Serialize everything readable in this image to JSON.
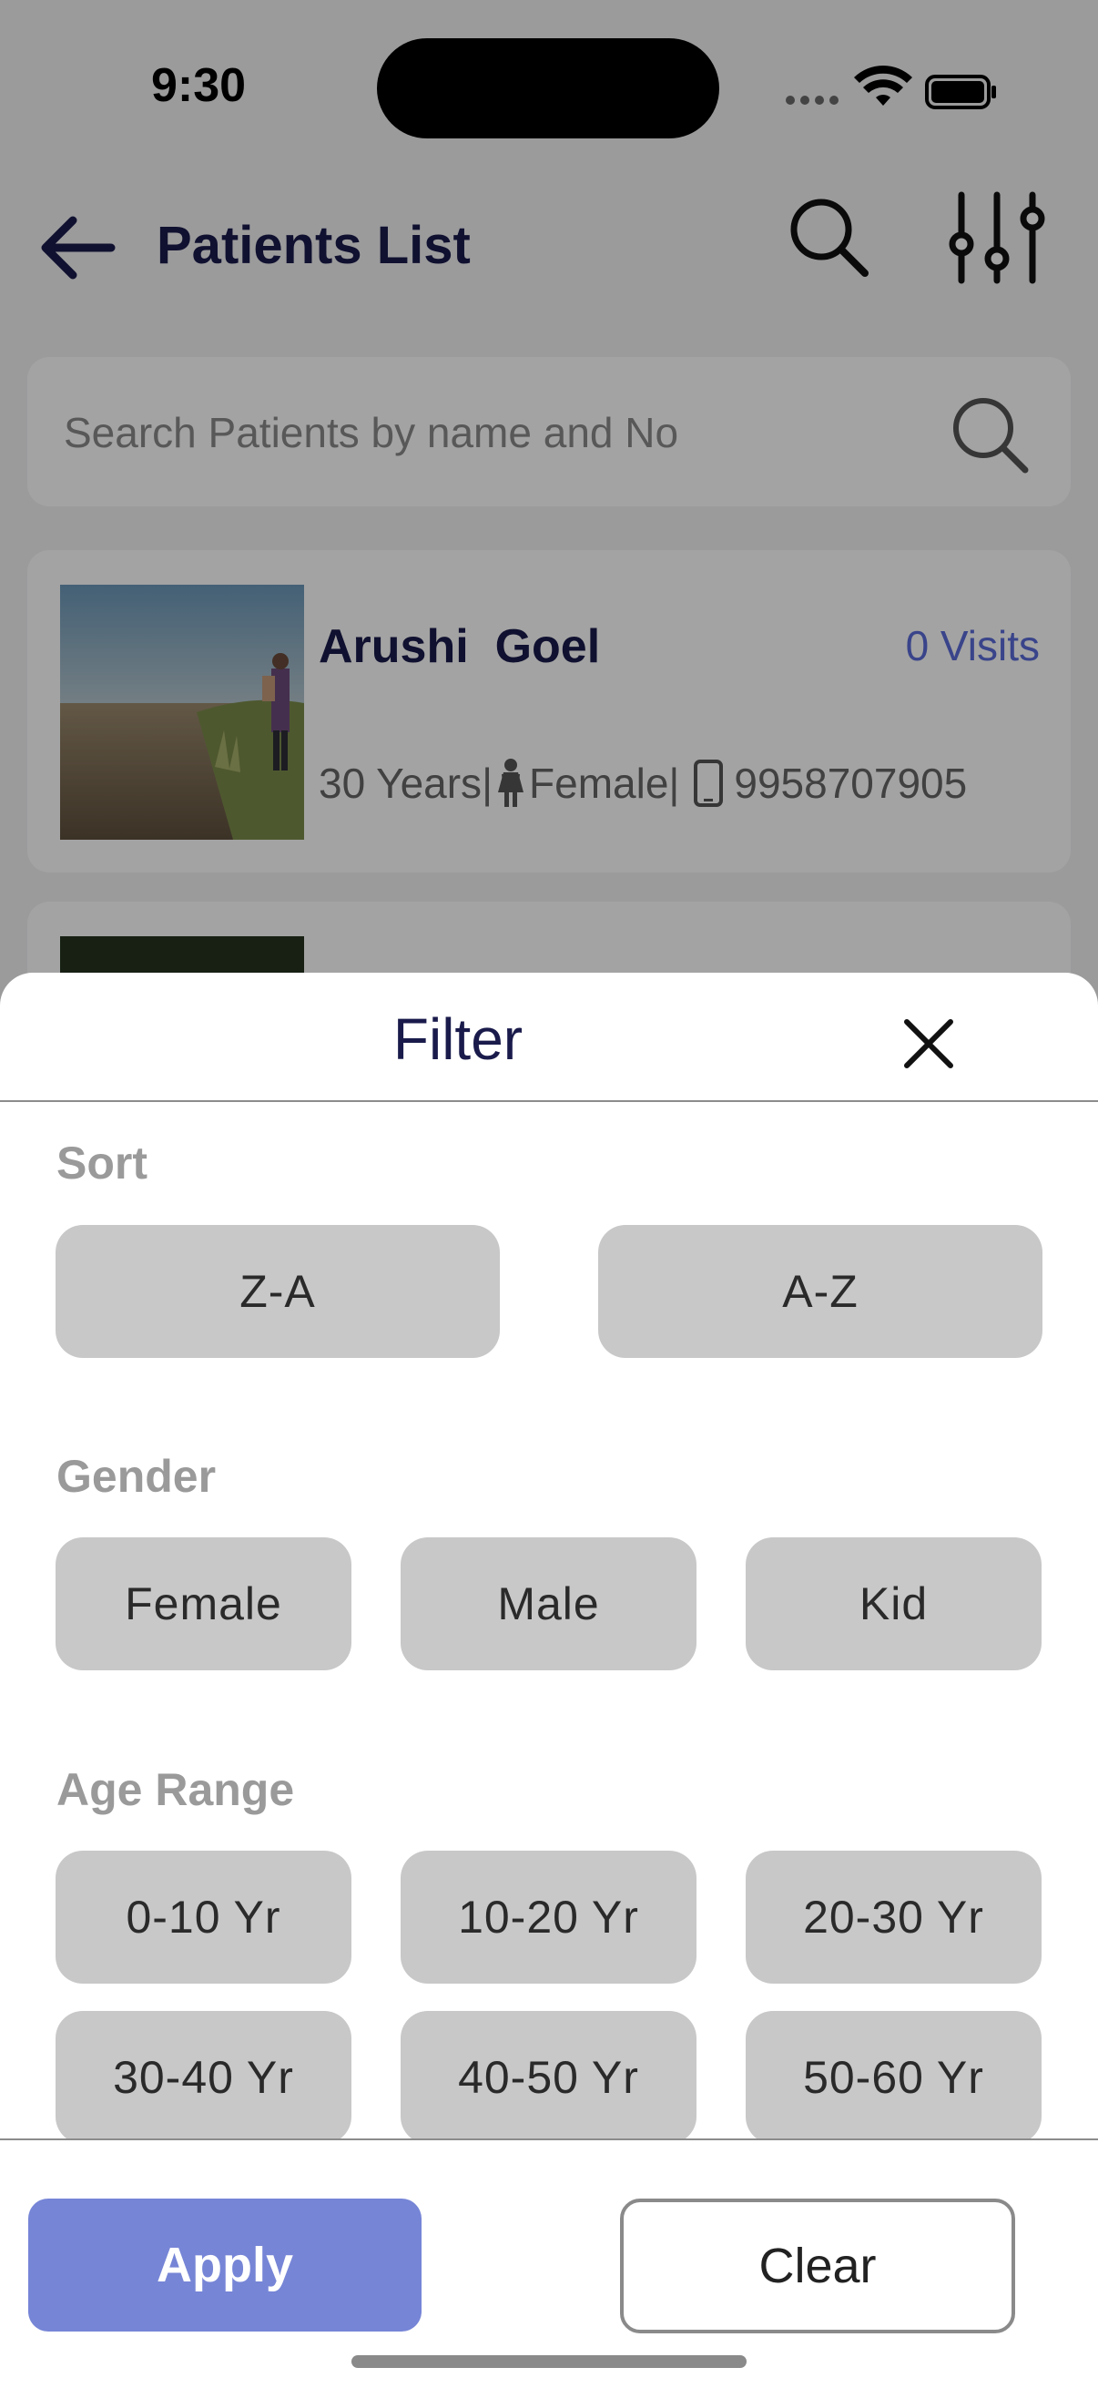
{
  "status_bar": {
    "time": "9:30"
  },
  "header": {
    "title": "Patients List"
  },
  "search": {
    "placeholder": "Search Patients by name and No"
  },
  "patients": [
    {
      "name": "Arushi  Goel",
      "visits": "0 Visits",
      "age": "30 Years",
      "sep": "|",
      "gender": "Female",
      "phone": "9958707905"
    }
  ],
  "filter": {
    "title": "Filter",
    "sort": {
      "label": "Sort",
      "options": [
        "Z-A",
        "A-Z"
      ]
    },
    "gender": {
      "label": "Gender",
      "options": [
        "Female",
        "Male",
        "Kid"
      ]
    },
    "age_range": {
      "label": "Age Range",
      "options": [
        "0-10 Yr",
        "10-20 Yr",
        "20-30 Yr",
        "30-40 Yr",
        "40-50 Yr",
        "50-60 Yr"
      ]
    },
    "apply_label": "Apply",
    "clear_label": "Clear"
  },
  "colors": {
    "primary_navy": "#1a1b4b",
    "accent_blue": "#7685d6",
    "visits_blue": "#5a6bd8",
    "chip_gray": "#c8c8c8"
  }
}
